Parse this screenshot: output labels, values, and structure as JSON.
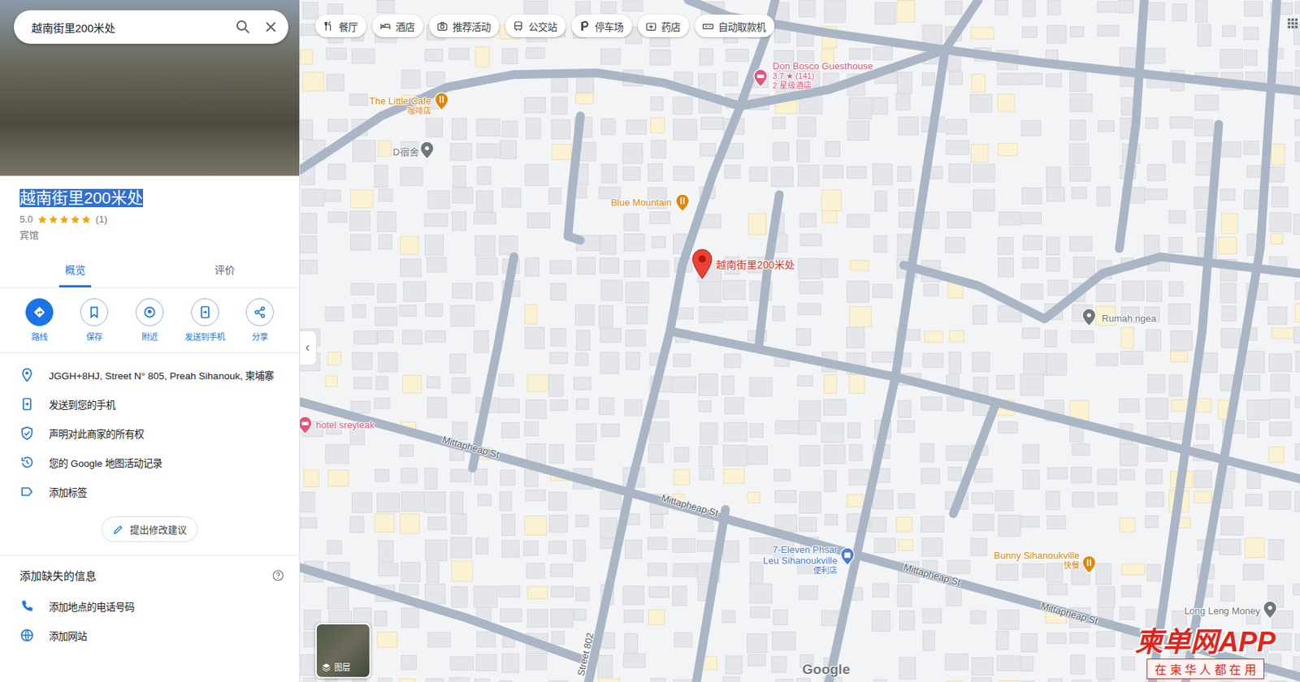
{
  "search": {
    "value": "越南街里200米处"
  },
  "place": {
    "title": "越南街里200米处",
    "title_selected": true,
    "rating": "5.0",
    "stars": 5,
    "review_count": "(1)",
    "category": "宾馆"
  },
  "tabs": [
    {
      "label": "概览",
      "selected": true
    },
    {
      "label": "评价",
      "selected": false
    }
  ],
  "actions": [
    {
      "label": "路线",
      "primary": true
    },
    {
      "label": "保存",
      "primary": false
    },
    {
      "label": "附近",
      "primary": false
    },
    {
      "label": "发送到手机",
      "primary": false
    },
    {
      "label": "分享",
      "primary": false
    }
  ],
  "info_rows": [
    {
      "text": "JGGH+8HJ, Street N° 805, Preah Sihanouk, 柬埔寨"
    },
    {
      "text": "发送到您的手机"
    },
    {
      "text": "声明对此商家的所有权"
    },
    {
      "text": "您的 Google 地图活动记录"
    },
    {
      "text": "添加标签"
    }
  ],
  "suggest_button": "提出修改建议",
  "missing_info": {
    "title": "添加缺失的信息",
    "items": [
      {
        "text": "添加地点的电话号码"
      },
      {
        "text": "添加网站"
      }
    ]
  },
  "chips": [
    "餐厅",
    "酒店",
    "推荐活动",
    "公交站",
    "停车场",
    "药店",
    "自动取款机"
  ],
  "map": {
    "pin": {
      "label": "越南街里200米处"
    },
    "places": [
      {
        "name_lines": [
          "Don Bosco Guesthouse"
        ],
        "sub": [
          "3.7 ★ (141)",
          "2 星级酒店"
        ],
        "kind": "lodging",
        "color": "#e0577c"
      },
      {
        "name_lines": [
          "The Little Cafe"
        ],
        "sub": [
          "咖啡店"
        ],
        "kind": "food",
        "color": "#e0860b"
      },
      {
        "name_lines": [
          "D宿舍"
        ],
        "sub": [],
        "kind": "generic",
        "color": "#6f767d"
      },
      {
        "name_lines": [
          "Blue Mountain"
        ],
        "sub": [],
        "kind": "food",
        "color": "#e0860b"
      },
      {
        "name_lines": [
          "Rumah ngea"
        ],
        "sub": [],
        "kind": "generic",
        "color": "#6f767d"
      },
      {
        "name_lines": [
          "hotel sreyleak"
        ],
        "sub": [],
        "kind": "lodging",
        "color": "#e0577c"
      },
      {
        "name_lines": [
          "7-Eleven Phsar",
          "Leu Sihanoukville"
        ],
        "sub": [
          "便利店"
        ],
        "kind": "shop",
        "color": "#4a7bd4"
      },
      {
        "name_lines": [
          "Bunny Sihanoukville"
        ],
        "sub": [
          "快餐"
        ],
        "kind": "food",
        "color": "#e0860b"
      },
      {
        "name_lines": [
          "Long Leng Money"
        ],
        "sub": [],
        "kind": "generic",
        "color": "#6f767d"
      }
    ],
    "streets": [
      "Mittapheap St",
      "Mittapheap St",
      "Mittapheap St",
      "Mittapheap St",
      "Street 802"
    ],
    "layers_label": "图层",
    "logo": "Google"
  },
  "watermark": {
    "title": "柬单网APP",
    "slogan": "在 柬 华 人 都 在 用"
  }
}
